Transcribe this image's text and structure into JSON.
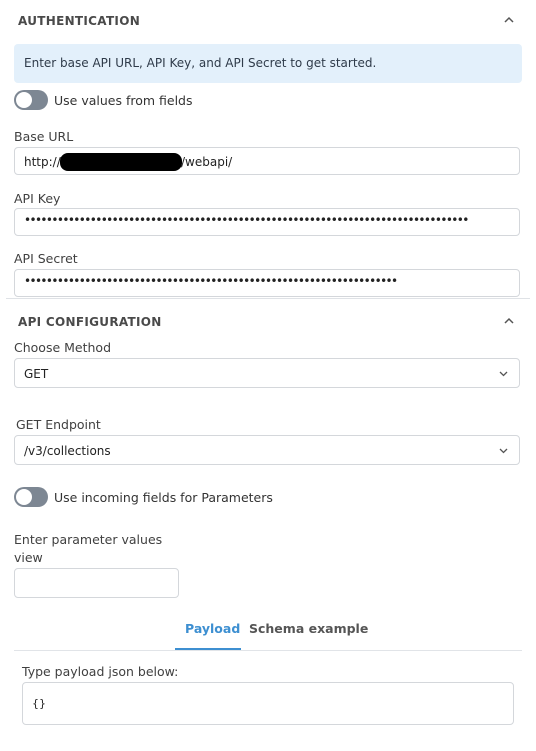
{
  "authentication": {
    "title": "AUTHENTICATION",
    "info": "Enter base API URL, API Key, and API Secret to get started.",
    "toggle_label": "Use values from fields",
    "base_url_label": "Base URL",
    "base_url_prefix": "http://",
    "base_url_suffix": "/webapi/",
    "api_key_label": "API Key",
    "api_key_value": "•••••••••••••••••••••••••••••••••••••••••••••••••••••••••••••••••••••••••••••••••",
    "api_secret_label": "API Secret",
    "api_secret_value": "••••••••••••••••••••••••••••••••••••••••••••••••••••••••••••••••••••"
  },
  "api_configuration": {
    "title": "API CONFIGURATION",
    "method_label": "Choose Method",
    "method_value": "GET",
    "endpoint_label": "GET Endpoint",
    "endpoint_value": "/v3/collections",
    "toggle_label": "Use incoming fields for Parameters",
    "param_label": "Enter parameter values",
    "param_sub_label": "view",
    "param_value": ""
  },
  "tabs": [
    {
      "label": "Payload",
      "active": true
    },
    {
      "label": "Schema example",
      "active": false
    }
  ],
  "payload": {
    "label": "Type payload json below:",
    "value": "{}"
  },
  "colors": {
    "accent": "#3d8fd1",
    "info_bg": "#e3f0fb",
    "toggle_off": "#7d8793"
  }
}
